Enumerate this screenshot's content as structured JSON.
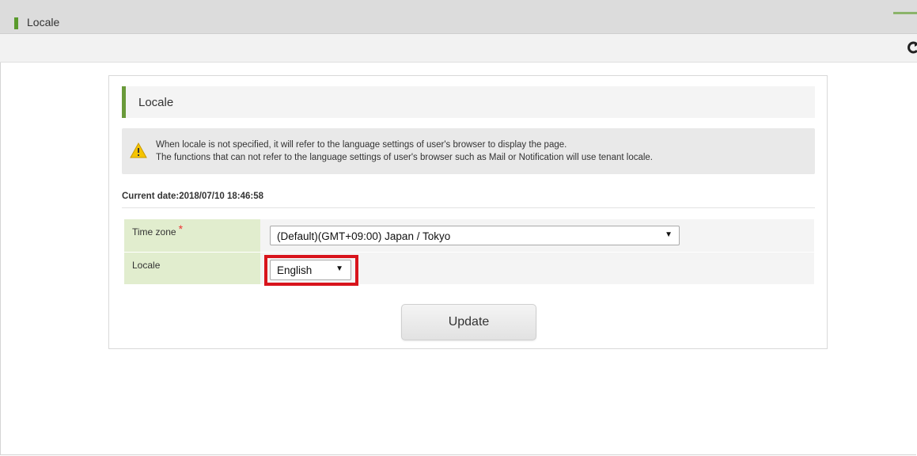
{
  "window": {
    "title": "Locale"
  },
  "section": {
    "title": "Locale"
  },
  "notice": {
    "line1": "When locale is not specified, it will refer to the language settings of user's browser to display the page.",
    "line2": "The functions that can not refer to the language settings of user's browser such as Mail or Notification will use tenant locale."
  },
  "current_date": "Current date:2018/07/10 18:46:58",
  "form": {
    "time_zone": {
      "label": "Time zone",
      "required_mark": "*",
      "value": "(Default)(GMT+09:00) Japan / Tokyo"
    },
    "locale": {
      "label": "Locale",
      "value": "English"
    }
  },
  "update_label": "Update",
  "icons": {
    "notice": "warning-icon",
    "toolbar": "refresh-icon",
    "dropdown": "dropdown-arrow-icon"
  },
  "colors": {
    "accent_green": "#6a9a3a",
    "label_bg": "#e1edce",
    "required": "#e33333",
    "highlight": "#d8141c",
    "warning": "#f5c400"
  }
}
